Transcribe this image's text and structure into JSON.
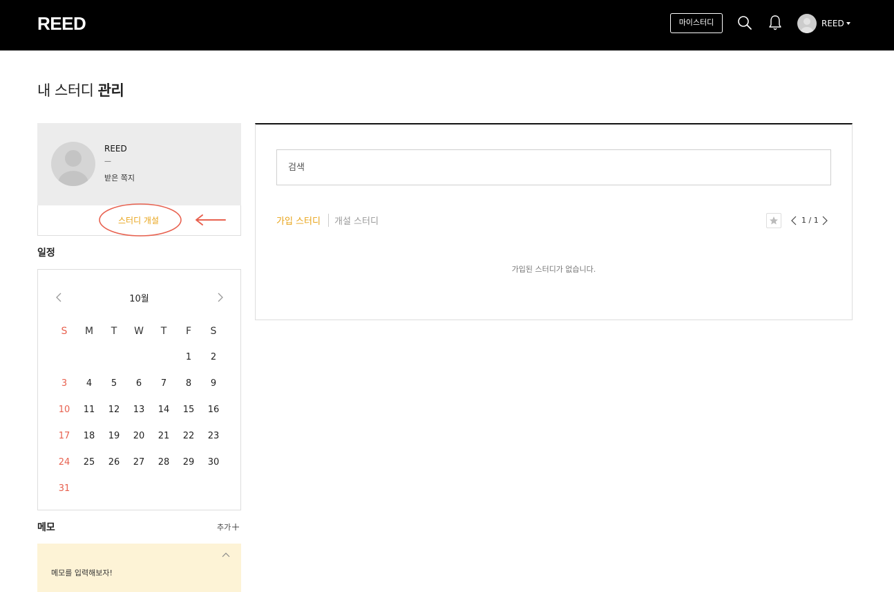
{
  "header": {
    "logo": "REED",
    "my_study_label": "마이스터디",
    "username": "REED"
  },
  "page": {
    "title_light": "내 스터디",
    "title_bold": "관리"
  },
  "profile": {
    "name": "REED",
    "dash": "—",
    "received_messages": "받은 쪽지",
    "open_study": "스터디 개설"
  },
  "schedule": {
    "title": "일정",
    "month": "10월",
    "weekdays": [
      "S",
      "M",
      "T",
      "W",
      "T",
      "F",
      "S"
    ],
    "weeks": [
      [
        "",
        "",
        "",
        "",
        "",
        "1",
        "2"
      ],
      [
        "3",
        "4",
        "5",
        "6",
        "7",
        "8",
        "9"
      ],
      [
        "10",
        "11",
        "12",
        "13",
        "14",
        "15",
        "16"
      ],
      [
        "17",
        "18",
        "19",
        "20",
        "21",
        "22",
        "23"
      ],
      [
        "24",
        "25",
        "26",
        "27",
        "28",
        "29",
        "30"
      ],
      [
        "31",
        "",
        "",
        "",
        "",
        "",
        ""
      ]
    ]
  },
  "memo": {
    "title": "메모",
    "add_label": "추가",
    "placeholder_text": "메모를 입력해보자!"
  },
  "main": {
    "search_placeholder": "검색",
    "tabs": [
      {
        "label": "가입 스터디",
        "active": true
      },
      {
        "label": "개설 스터디",
        "active": false
      }
    ],
    "pagination": "1 / 1",
    "empty_message": "가입된 스터디가 없습니다."
  },
  "colors": {
    "accent": "#e8a317",
    "annotation": "#e8614f",
    "sunday": "#e8614f"
  }
}
